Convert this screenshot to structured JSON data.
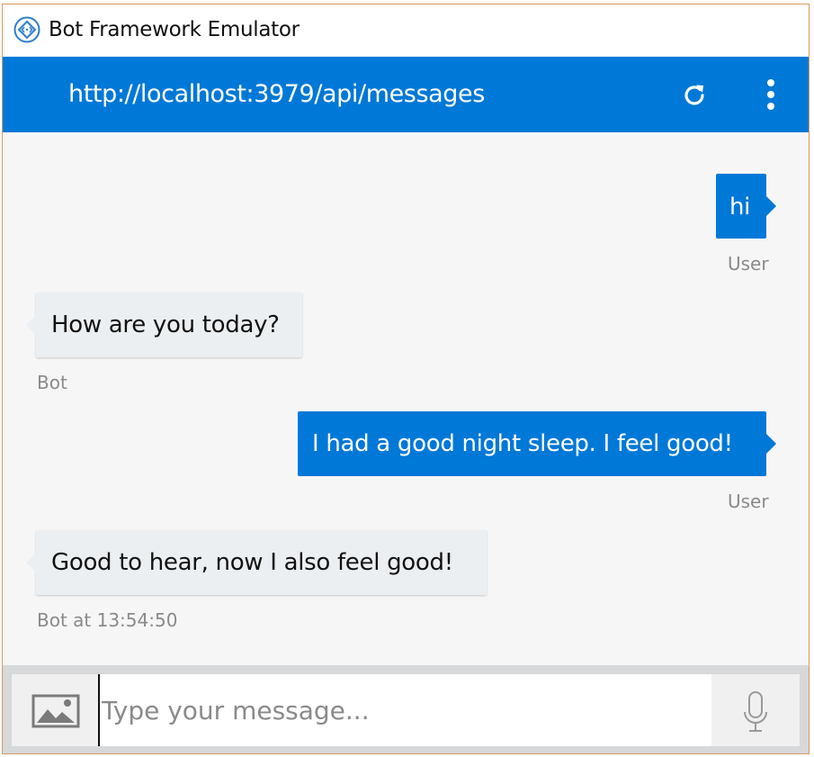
{
  "window": {
    "title": "Bot Framework Emulator"
  },
  "header": {
    "endpoint_url": "http://localhost:3979/api/messages",
    "refresh_icon": "refresh-icon",
    "more_icon": "more-vertical-icon"
  },
  "messages": [
    {
      "from": "user",
      "text": "hi",
      "meta": "User"
    },
    {
      "from": "bot",
      "text": "How are you today?",
      "meta": "Bot"
    },
    {
      "from": "user",
      "text": "I had a good night sleep. I feel good!",
      "meta": "User"
    },
    {
      "from": "bot",
      "text": "Good to hear, now I also feel good!",
      "meta": "Bot at 13:54:50"
    }
  ],
  "composer": {
    "placeholder": "Type your message...",
    "upload_icon": "image-upload-icon",
    "mic_icon": "microphone-icon"
  },
  "colors": {
    "accent": "#0078d7",
    "bot_bubble": "#eceff1",
    "chat_background": "#f6f6f6",
    "meta_text": "#8a8a8a"
  }
}
